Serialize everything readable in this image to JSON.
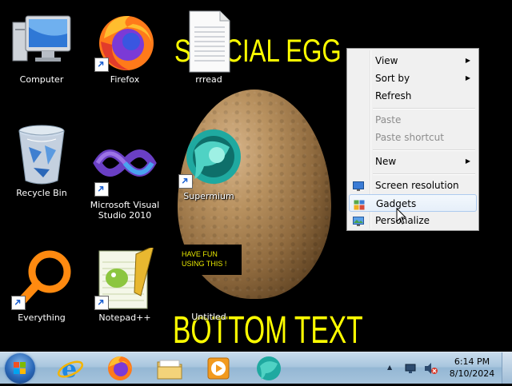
{
  "wallpaper": {
    "title_text": "SPECIAL EGG",
    "bottom_text": "BOTTOM TEXT",
    "note_line1": "HAVE FUN",
    "note_line2": "USING THIS !"
  },
  "desktop_icons": [
    {
      "label": "Computer",
      "icon": "computer-icon",
      "shortcut": false
    },
    {
      "label": "Firefox",
      "icon": "firefox-icon",
      "shortcut": true
    },
    {
      "label": "rrread",
      "icon": "text-file-icon",
      "shortcut": false
    },
    {
      "label": "Recycle Bin",
      "icon": "recycle-bin-icon",
      "shortcut": false
    },
    {
      "label": "Microsoft Visual Studio 2010",
      "icon": "visual-studio-icon",
      "shortcut": true
    },
    {
      "label": "Supermium",
      "icon": "supermium-icon",
      "shortcut": true
    },
    {
      "label": "Everything",
      "icon": "everything-search-icon",
      "shortcut": true
    },
    {
      "label": "Notepad++",
      "icon": "notepad-plus-plus-icon",
      "shortcut": true
    },
    {
      "label": "Untitled",
      "icon": "untitled-icon",
      "shortcut": false
    }
  ],
  "context_menu": {
    "items": [
      {
        "label": "View",
        "submenu": true,
        "enabled": true
      },
      {
        "label": "Sort by",
        "submenu": true,
        "enabled": true
      },
      {
        "label": "Refresh",
        "submenu": false,
        "enabled": true
      },
      {
        "label": "Paste",
        "submenu": false,
        "enabled": false
      },
      {
        "label": "Paste shortcut",
        "submenu": false,
        "enabled": false
      },
      {
        "label": "New",
        "submenu": true,
        "enabled": true
      },
      {
        "label": "Screen resolution",
        "submenu": false,
        "enabled": true,
        "icon": "screen-resolution-icon"
      },
      {
        "label": "Gadgets",
        "submenu": false,
        "enabled": true,
        "icon": "gadgets-icon",
        "highlighted": true
      },
      {
        "label": "Personalize",
        "submenu": false,
        "enabled": true,
        "icon": "personalize-icon"
      }
    ],
    "arrow_glyph": "▶"
  },
  "taskbar": {
    "pinned": [
      "internet-explorer-icon",
      "firefox-icon",
      "file-explorer-icon",
      "media-player-icon",
      "supermium-icon"
    ],
    "clock_time": "6:14 PM",
    "clock_date": "8/10/2024"
  },
  "colors": {
    "wallpaper_text": "#ffff00",
    "menu_bg": "#f0f0f0",
    "menu_highlight_border": "#aecbef"
  }
}
